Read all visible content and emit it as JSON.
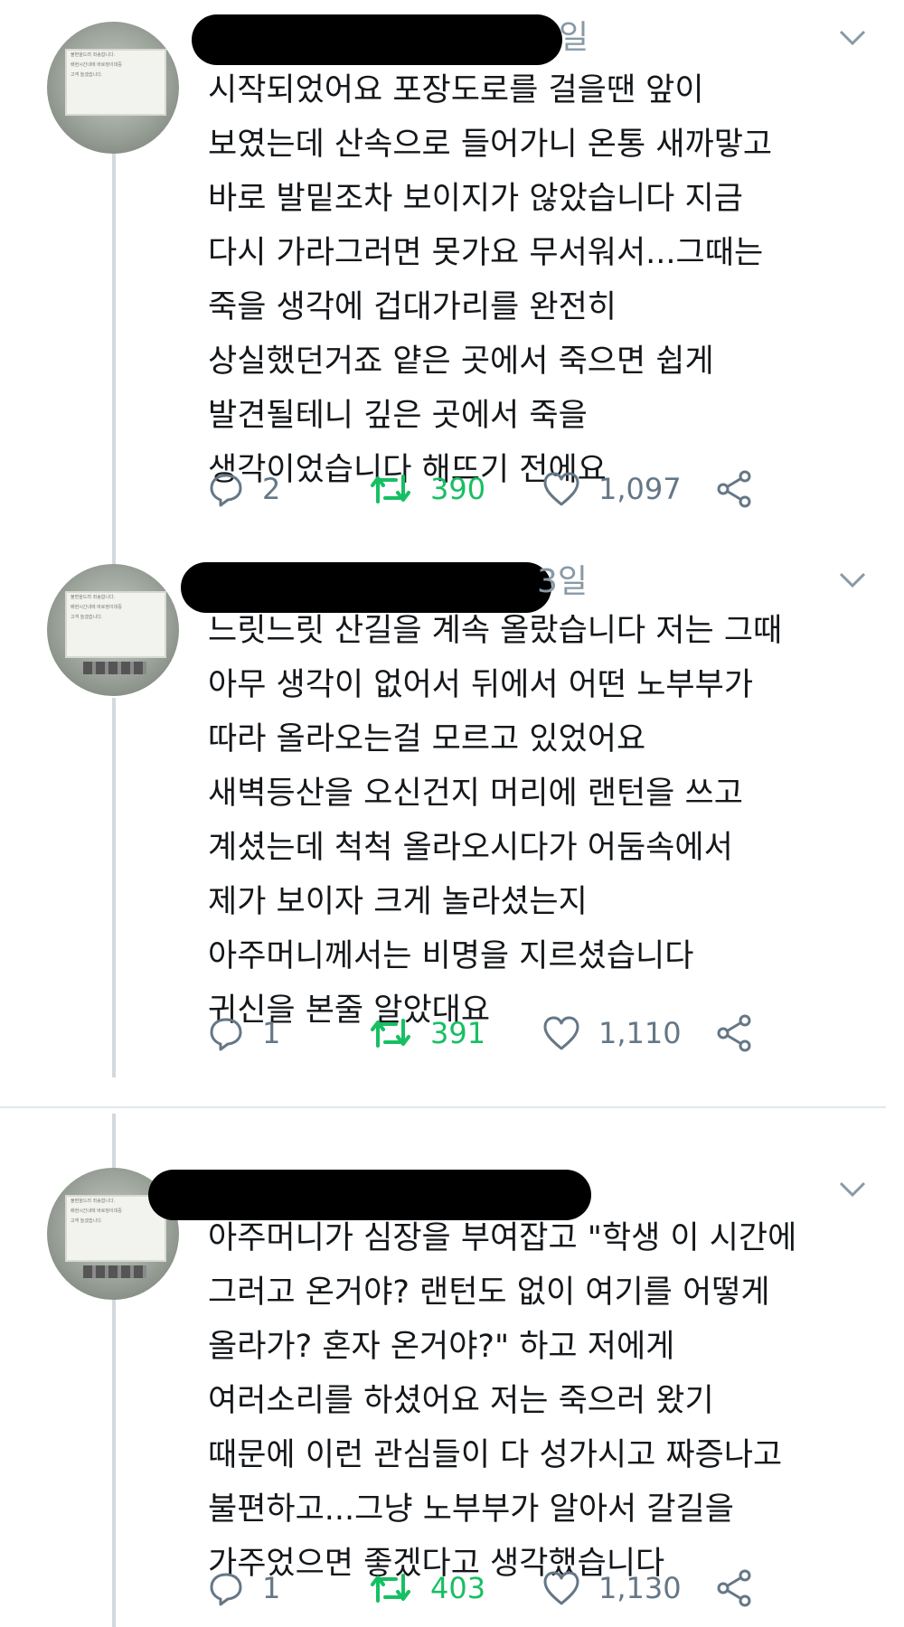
{
  "tweets": [
    {
      "date": "일",
      "text": "시작되었어요 포장도로를 걸을땐 앞이\n보였는데 산속으로 들어가니 온통 새까맣고\n바로 발밑조차 보이지가 않았습니다 지금\n다시 가라그러면 못가요 무서워서...그때는\n죽을 생각에 겁대가리를 완전히\n상실했던거죠 얕은 곳에서 죽으면 쉽게\n발견될테니 깊은 곳에서 죽을\n생각이었습니다 해뜨기 전에요",
      "replies": "2",
      "retweets": "390",
      "likes": "1,097"
    },
    {
      "date": "3일",
      "text": "느릿느릿 산길을 계속 올랐습니다 저는 그때\n아무 생각이 없어서 뒤에서 어떤 노부부가\n따라 올라오는걸 모르고 있었어요\n새벽등산을 오신건지 머리에 랜턴을 쓰고\n계셨는데 척척 올라오시다가 어둠속에서\n제가 보이자 크게 놀라셨는지\n아주머니께서는 비명을 지르셨습니다\n귀신을 본줄 알았대요",
      "replies": "1",
      "retweets": "391",
      "likes": "1,110"
    },
    {
      "date": "",
      "text": "아주머니가 심장을 부여잡고 \"학생 이 시간에\n그러고 온거야? 랜턴도 없이 여기를 어떻게\n올라가? 혼자 온거야?\" 하고 저에게\n여러소리를 하셨어요 저는 죽으러 왔기\n때문에 이런 관심들이 다 성가시고 짜증나고\n불편하고...그냥 노부부가 알아서 갈길을\n가주었으면 좋겠다고 생각했습니다",
      "replies": "1",
      "retweets": "403",
      "likes": "1,130"
    }
  ],
  "avatar_screen_text": [
    "불편을드려 죄송합니다.",
    "배현시간내에 바로정이대중",
    "고객 놀겠습니다."
  ],
  "colors": {
    "text": "#14171a",
    "muted": "#657786",
    "retweet_green": "#17bf63",
    "thread_line": "#d2d9de",
    "divider": "#e1e8ed"
  },
  "icons": [
    "reply-icon",
    "retweet-icon",
    "like-icon",
    "share-icon",
    "chevron-down-icon"
  ]
}
